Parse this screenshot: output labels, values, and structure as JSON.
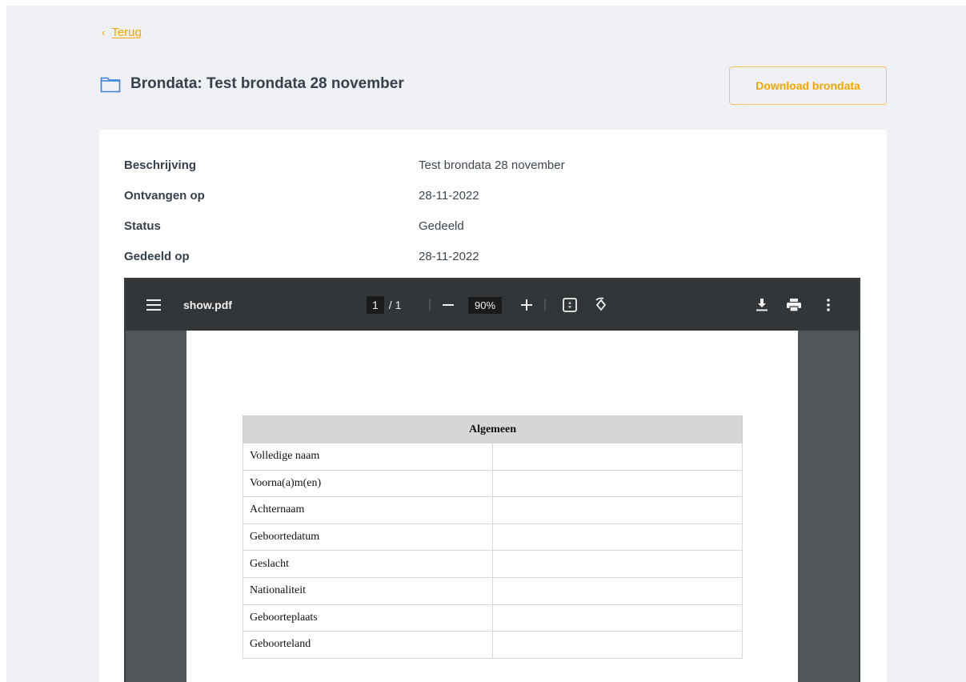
{
  "nav": {
    "back_chevron": "‹",
    "back_label": "Terug"
  },
  "header": {
    "title": "Brondata: Test brondata 28 november",
    "folder_icon": "folder-icon",
    "download_label": "Download brondata"
  },
  "details": [
    {
      "label": "Beschrijving",
      "value": "Test brondata 28 november"
    },
    {
      "label": "Ontvangen op",
      "value": "28-11-2022"
    },
    {
      "label": "Status",
      "value": "Gedeeld"
    },
    {
      "label": "Gedeeld op",
      "value": "28-11-2022"
    }
  ],
  "viewer": {
    "filename": "show.pdf",
    "current_page": "1",
    "total_pages": "/ 1",
    "zoom": "90%",
    "table_header": "Algemeen",
    "rows": [
      "Volledige naam",
      "Voorna(a)m(en)",
      "Achternaam",
      "Geboortedatum",
      "Geslacht",
      "Nationaliteit",
      "Geboorteplaats",
      "Geboorteland"
    ]
  },
  "colors": {
    "accent": "#f0a800",
    "toolbar": "#323639",
    "viewer_bg": "#535659"
  }
}
